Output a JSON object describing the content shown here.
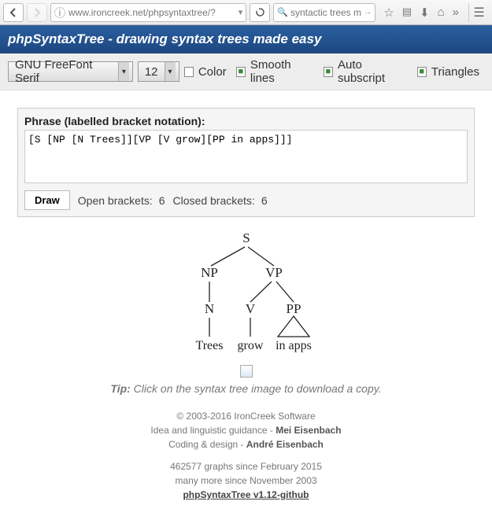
{
  "browser": {
    "url": "www.ironcreek.net/phpsyntaxtree/?",
    "search_value": "syntactic trees m"
  },
  "header": {
    "title": "phpSyntaxTree - drawing syntax trees made easy"
  },
  "options": {
    "font_name": "GNU FreeFont Serif",
    "font_size": "12",
    "color_label": "Color",
    "smooth_label": "Smooth lines",
    "autosub_label": "Auto subscript",
    "triangles_label": "Triangles"
  },
  "phrase": {
    "label": "Phrase (labelled bracket notation):",
    "value": "[S [NP [N Trees]][VP [V grow][PP in apps]]]",
    "draw_btn": "Draw",
    "open_label": "Open brackets:",
    "open_count": "6",
    "closed_label": "Closed brackets:",
    "closed_count": "6"
  },
  "tree": {
    "nodes": {
      "s": "S",
      "np": "NP",
      "vp": "VP",
      "n": "N",
      "v": "V",
      "pp": "PP"
    },
    "leaves": {
      "trees": "Trees",
      "grow": "grow",
      "inapps": "in apps"
    }
  },
  "tip": {
    "prefix": "Tip:",
    "text": " Click on the syntax tree image to download a copy."
  },
  "footer": {
    "copyright": "© 2003-2016 IronCreek Software",
    "idea_prefix": "Idea and linguistic guidance - ",
    "idea_name": "Mei Eisenbach",
    "coding_prefix": "Coding & design - ",
    "coding_name": "André Eisenbach",
    "since1": "462577 graphs since February 2015",
    "since2": "many more since November 2003",
    "link": "phpSyntaxTree v1.12-github"
  }
}
